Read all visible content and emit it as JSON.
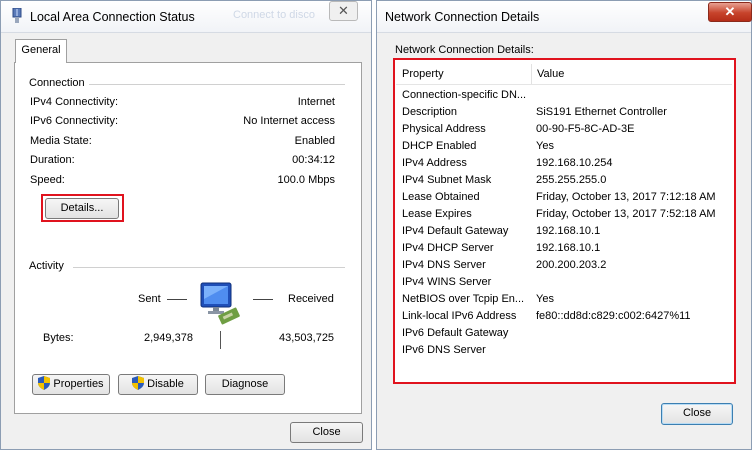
{
  "left_window": {
    "title": "Local Area Connection Status",
    "tab_general": "General",
    "connection_group": "Connection",
    "rows": [
      {
        "label": "IPv4 Connectivity:",
        "value": "Internet"
      },
      {
        "label": "IPv6 Connectivity:",
        "value": "No Internet access"
      },
      {
        "label": "Media State:",
        "value": "Enabled"
      },
      {
        "label": "Duration:",
        "value": "00:34:12"
      },
      {
        "label": "Speed:",
        "value": "100.0 Mbps"
      }
    ],
    "details_button": "Details...",
    "activity_group": "Activity",
    "sent_label": "Sent",
    "received_label": "Received",
    "bytes_label": "Bytes:",
    "bytes_sent": "2,949,378",
    "bytes_received": "43,503,725",
    "properties_button": "Properties",
    "disable_button": "Disable",
    "diagnose_button": "Diagnose",
    "close_button": "Close",
    "background_text": "Connect to disco"
  },
  "right_window": {
    "title": "Network Connection Details",
    "list_caption": "Network Connection Details:",
    "col_property": "Property",
    "col_value": "Value",
    "details": [
      {
        "property": "Connection-specific DN...",
        "value": ""
      },
      {
        "property": "Description",
        "value": "SiS191 Ethernet Controller"
      },
      {
        "property": "Physical Address",
        "value": "00-90-F5-8C-AD-3E"
      },
      {
        "property": "DHCP Enabled",
        "value": "Yes"
      },
      {
        "property": "IPv4 Address",
        "value": "192.168.10.254"
      },
      {
        "property": "IPv4 Subnet Mask",
        "value": "255.255.255.0"
      },
      {
        "property": "Lease Obtained",
        "value": "Friday, October 13, 2017 7:12:18 AM"
      },
      {
        "property": "Lease Expires",
        "value": "Friday, October 13, 2017 7:52:18 AM"
      },
      {
        "property": "IPv4 Default Gateway",
        "value": "192.168.10.1"
      },
      {
        "property": "IPv4 DHCP Server",
        "value": "192.168.10.1"
      },
      {
        "property": "IPv4 DNS Server",
        "value": "200.200.203.2"
      },
      {
        "property": "IPv4 WINS Server",
        "value": ""
      },
      {
        "property": "NetBIOS over Tcpip En...",
        "value": "Yes"
      },
      {
        "property": "Link-local IPv6 Address",
        "value": "fe80::dd8d:c829:c002:6427%11"
      },
      {
        "property": "IPv6 Default Gateway",
        "value": ""
      },
      {
        "property": "IPv6 DNS Server",
        "value": ""
      }
    ],
    "close_button": "Close"
  },
  "icons": {
    "network_adapter": "network-adapter-icon",
    "uac_shield": "uac-shield-icon",
    "close_x": "close-icon"
  },
  "colors": {
    "highlight_box": "#e0131e",
    "window_bg": "#f0f0f0",
    "close_button_red": "#c7432b"
  }
}
